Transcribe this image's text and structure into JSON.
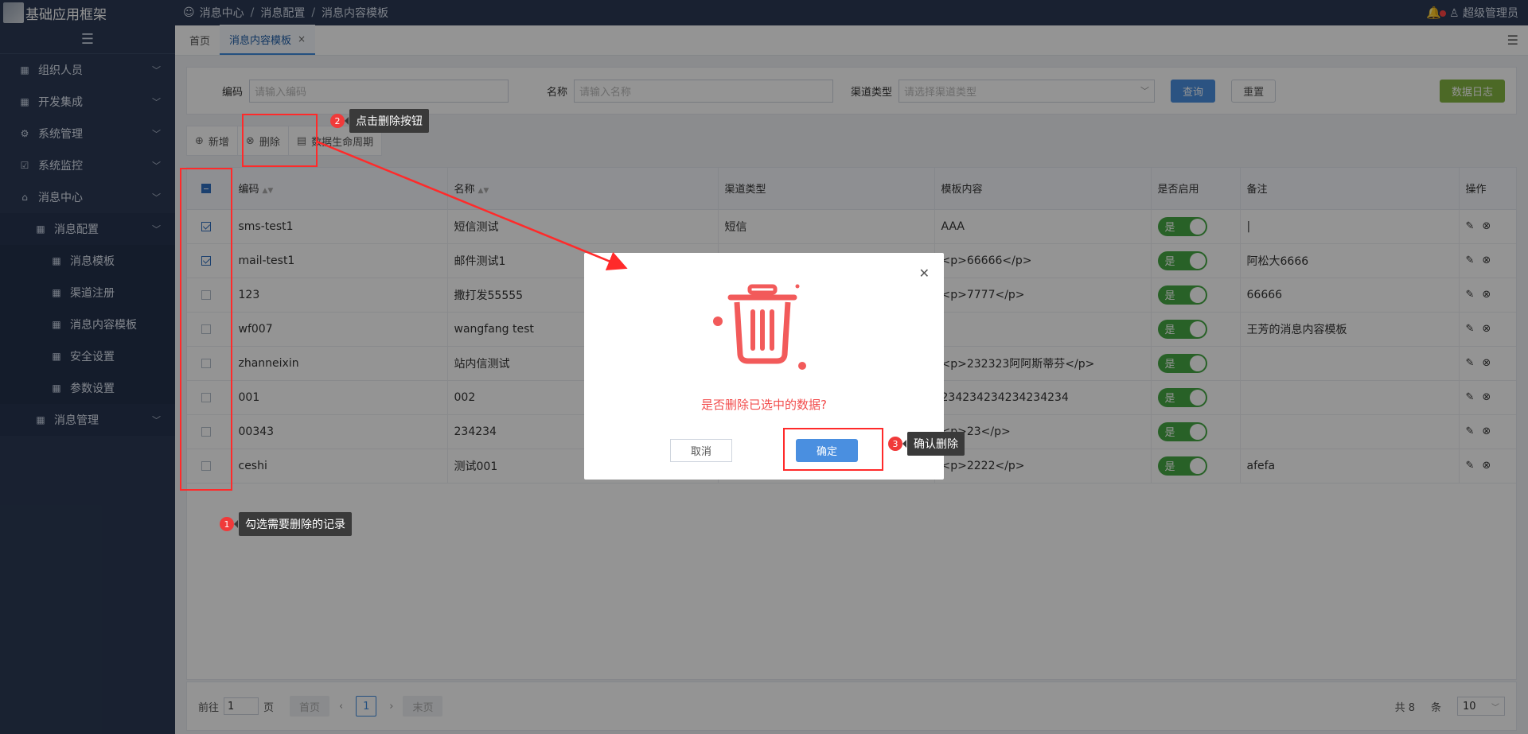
{
  "app": {
    "title": "基础应用框架"
  },
  "breadcrumb": [
    "消息中心",
    "消息配置",
    "消息内容模板"
  ],
  "user": {
    "name": "超级管理员"
  },
  "sidebar": {
    "items": [
      {
        "label": "组织人员"
      },
      {
        "label": "开发集成"
      },
      {
        "label": "系统管理"
      },
      {
        "label": "系统监控"
      },
      {
        "label": "消息中心"
      },
      {
        "label": "消息配置"
      },
      {
        "label": "消息模板"
      },
      {
        "label": "渠道注册"
      },
      {
        "label": "消息内容模板"
      },
      {
        "label": "安全设置"
      },
      {
        "label": "参数设置"
      },
      {
        "label": "消息管理"
      }
    ]
  },
  "tabs": [
    {
      "label": "首页"
    },
    {
      "label": "消息内容模板"
    }
  ],
  "filter": {
    "code_label": "编码",
    "code_placeholder": "请输入编码",
    "name_label": "名称",
    "name_placeholder": "请输入名称",
    "channel_label": "渠道类型",
    "channel_placeholder": "请选择渠道类型",
    "query": "查询",
    "reset": "重置",
    "log": "数据日志"
  },
  "toolbar": {
    "add": "新增",
    "delete": "删除",
    "lifecycle": "数据生命周期"
  },
  "table": {
    "headers": [
      "编码",
      "名称",
      "渠道类型",
      "模板内容",
      "是否启用",
      "备注",
      "操作"
    ],
    "rows": [
      {
        "code": "sms-test1",
        "name": "短信测试",
        "channel": "短信",
        "content": "AAA",
        "enabled": "是",
        "remark": "|",
        "checked": true
      },
      {
        "code": "mail-test1",
        "name": "邮件测试1",
        "channel": "",
        "content": "<p>66666</p>",
        "enabled": "是",
        "remark": "阿松大6666",
        "checked": true
      },
      {
        "code": "123",
        "name": "撒打发55555",
        "channel": "",
        "content": "<p>7777</p>",
        "enabled": "是",
        "remark": "66666",
        "checked": false
      },
      {
        "code": "wf007",
        "name": "wangfang test",
        "channel": "",
        "content": "",
        "enabled": "是",
        "remark": "王芳的消息内容模板",
        "checked": false
      },
      {
        "code": "zhanneixin",
        "name": "站内信测试",
        "channel": "",
        "content": "<p>232323阿阿斯蒂芬</p>",
        "enabled": "是",
        "remark": "",
        "checked": false
      },
      {
        "code": "001",
        "name": "002",
        "channel": "",
        "content": "234234234234234234",
        "enabled": "是",
        "remark": "",
        "checked": false
      },
      {
        "code": "00343",
        "name": "234234",
        "channel": "",
        "content": "<p>23</p>",
        "enabled": "是",
        "remark": "",
        "checked": false
      },
      {
        "code": "ceshi",
        "name": "测试001",
        "channel": "",
        "content": "<p>2222</p>",
        "enabled": "是",
        "remark": "afefa",
        "checked": false
      }
    ]
  },
  "pager": {
    "goto": "前往",
    "page_value": "1",
    "page_unit": "页",
    "first": "首页",
    "current": "1",
    "last": "末页",
    "total": "共 8",
    "item_unit": "条",
    "page_size": "10"
  },
  "modal": {
    "message": "是否删除已选中的数据?",
    "cancel": "取消",
    "confirm": "确定"
  },
  "annotations": [
    {
      "num": "1",
      "text": "勾选需要删除的记录"
    },
    {
      "num": "2",
      "text": "点击删除按钮"
    },
    {
      "num": "3",
      "text": "确认删除"
    }
  ],
  "colors": {
    "sidebar": "#2b3a55",
    "primary": "#4a8fe0",
    "switch": "#45a844",
    "annotation_red": "#ff2a2a",
    "danger_text": "#f24c4c"
  }
}
